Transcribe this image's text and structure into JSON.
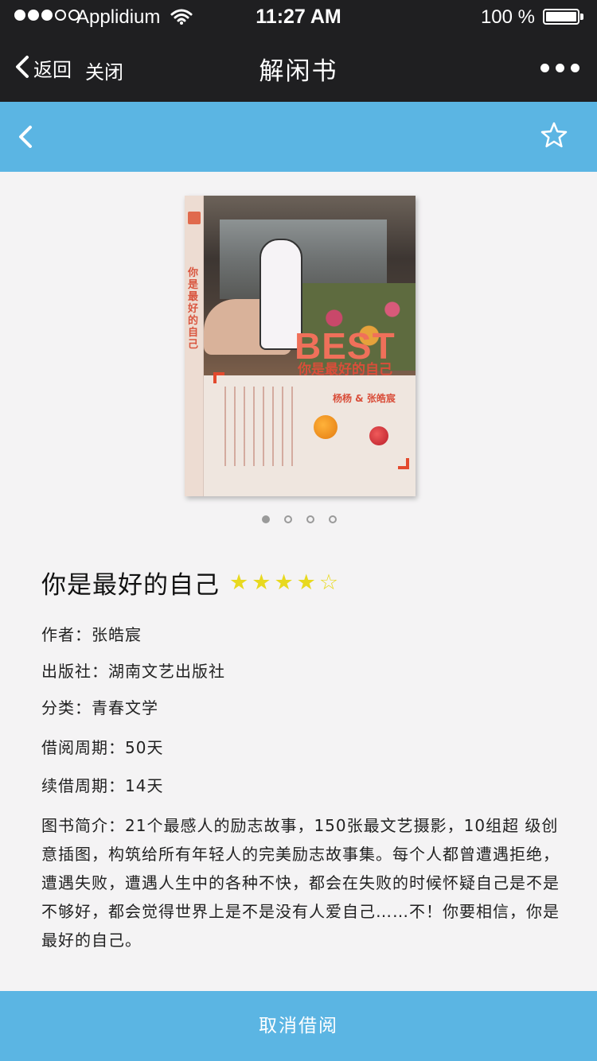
{
  "status_bar": {
    "carrier": "Applidium",
    "time": "11:27 AM",
    "battery": "100 %"
  },
  "nav": {
    "back_label": "返回",
    "close_label": "关闭",
    "title": "解闲书"
  },
  "book": {
    "cover_best": "BEST",
    "cover_subtitle": "你是最好的自己",
    "cover_authors": "杨杨 & 张皓宸",
    "cover_spine_title": "你是最好的自己",
    "title": "你是最好的自己",
    "rating": {
      "filled": 4,
      "total": 5,
      "filled_glyph": "★",
      "empty_glyph": "☆",
      "color": "#e8d91f"
    },
    "author": {
      "label": "作者：",
      "value": "张皓宸"
    },
    "publisher": {
      "label": "出版社：",
      "value": "湖南文艺出版社"
    },
    "category": {
      "label": "分类：",
      "value": "青春文学"
    },
    "loan_period": {
      "label": "借阅周期：",
      "value": "50天"
    },
    "renew_period": {
      "label": "续借周期：",
      "value": "14天"
    },
    "summary": {
      "label": "图书简介：",
      "value": "21个最感人的励志故事，150张最文艺摄影，10组超 级创意插图，构筑给所有年轻人的完美励志故事集。每个人都曾遭遇拒绝，遭遇失败，遭遇人生中的各种不快，都会在失败的时候怀疑自己是不是不够好，都会觉得世界上是不是没有人爱自己……不！你要相信，你是最好的自己。"
    }
  },
  "pager": {
    "count": 4,
    "active": 0
  },
  "action": {
    "cancel_loan_label": "取消借阅"
  },
  "colors": {
    "accent": "#5bb5e3",
    "dark_bar": "#1f1f21",
    "background": "#f4f3f4"
  }
}
